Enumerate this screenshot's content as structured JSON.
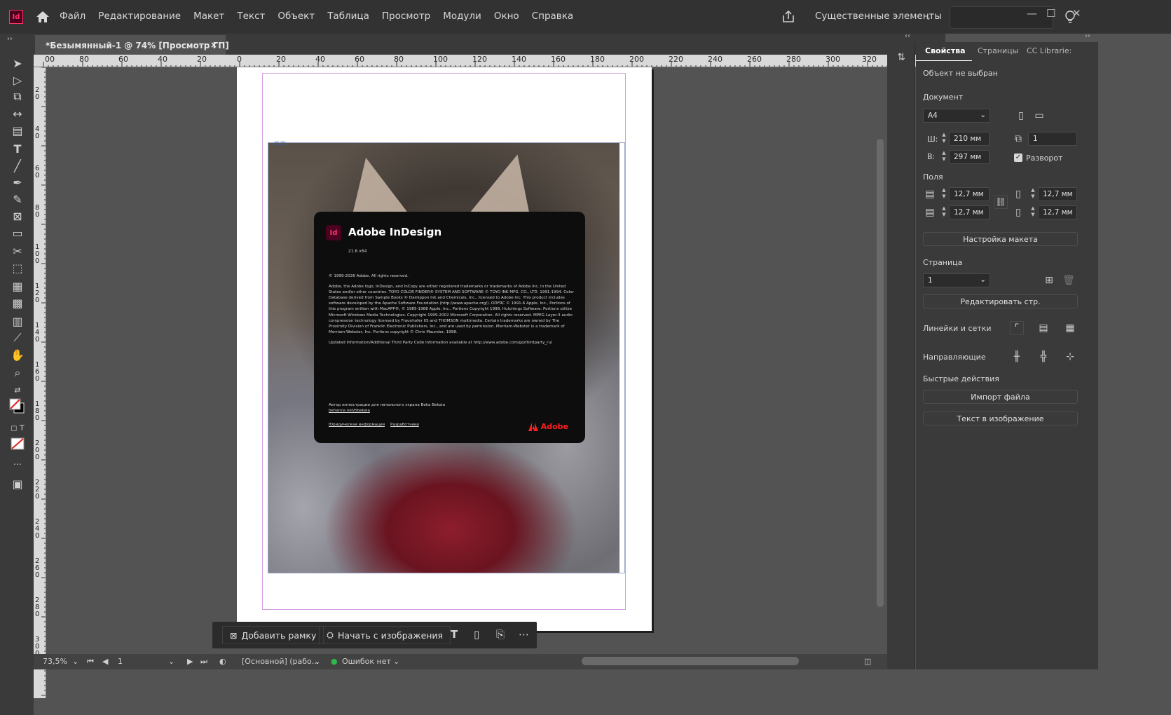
{
  "app": {
    "logo_text": "Id"
  },
  "menu": [
    "Файл",
    "Редактирование",
    "Макет",
    "Текст",
    "Объект",
    "Таблица",
    "Просмотр",
    "Модули",
    "Окно",
    "Справка"
  ],
  "workspace": {
    "label": "Существенные элементы"
  },
  "document_tab": {
    "title": "*Безымянный-1 @ 74% [Просмотр ГП]",
    "close": "×"
  },
  "ruler": {
    "h_ticks": [
      "00",
      "80",
      "60",
      "40",
      "20",
      "0",
      "20",
      "40",
      "60",
      "80",
      "100",
      "120",
      "140",
      "160",
      "180",
      "200",
      "220",
      "240",
      "260",
      "280",
      "300",
      "320"
    ],
    "v_ticks": [
      "2 0",
      "4 0",
      "6 0",
      "8 0",
      "1 0 0",
      "1 2 0",
      "1 4 0",
      "1 6 0",
      "1 8 0",
      "2 0 0",
      "2 2 0",
      "2 4 0",
      "2 6 0",
      "2 8 0",
      "3 0 0"
    ]
  },
  "splash": {
    "logo_text": "Id",
    "title": "Adobe InDesign",
    "version": "21.6 x64",
    "legal": [
      "© 1999-2026 Adobe. All rights reserved.",
      "Adobe, the Adobe logo, InDesign, and InCopy are either registered trademarks or trademarks of Adobe Inc. in the United States and/or other countries. TOYO COLOR FINDER® SYSTEM AND SOFTWARE © TOYO INK MFG. CO., LTD. 1991-1994. Color Database derived from Sample Books © Dainippon Ink and Chemicals, Inc., licensed to Adobe Inc. This product includes software developed by the Apache Software Foundation (http://www.apache.org/). ODFRC © 1991-6 Apple, Inc., Portions of this program written with MacAPP®, © 1985-1988 Apple, Inc., Portions Copyright 1998, Hutchings Software. Portions utilize Microsoft Windows Media Technologies. Copyright 1999-2002 Microsoft Corporation. All rights reserved. MPEG Layer-3 audio compression technology licensed by Fraunhofer IIS and THOMSON multimedia. Certain trademarks are owned by The Proximity Division of Franklin Electronic Publishers, Inc., and are used by permission. Merriam-Webster is a trademark of Merriam-Webster, Inc. Portions copyright © Chris Maunder, 1998.",
      "Updated Information/Additional Third Party Code Information available at http://www.adobe.com/go/thirdparty_ru/"
    ],
    "credit": "Автор иллюстрации для начального экрана Beka Bekaia",
    "credit_link": "behance.net/bbekaia",
    "link_legal": "Юридическая информация",
    "link_dev": "Разработчики",
    "adobe": "Adobe"
  },
  "contextbar": {
    "add_frame": "Добавить рамку",
    "start_image": "Начать с изображения"
  },
  "status": {
    "zoom": "73,5%",
    "page": "1",
    "style": "[Основной] (рабо...",
    "errors": "Ошибок нет"
  },
  "panel": {
    "tabs": [
      "Свойства",
      "Страницы",
      "CC Librarie:"
    ],
    "no_selection": "Объект не выбран",
    "document_label": "Документ",
    "page_size": "A4",
    "width_label": "Ш:",
    "width": "210 мм",
    "height_label": "В:",
    "height": "297 мм",
    "pages_count": "1",
    "facing_label": "Разворот",
    "margins_label": "Поля",
    "margin_top": "12,7 мм",
    "margin_bottom": "12,7 мм",
    "margin_left": "12,7 мм",
    "margin_right": "12,7 мм",
    "layout_btn": "Настройка макета",
    "page_label": "Страница",
    "page_value": "1",
    "edit_page_btn": "Редактировать стр.",
    "rulers_label": "Линейки и сетки",
    "guides_label": "Направляющие",
    "quick_label": "Быстрые действия",
    "import_btn": "Импорт файла",
    "text_image_btn": "Текст в изображение"
  },
  "colors": {
    "accent_id": "#ff3366",
    "adobe_red": "#ff1f1f",
    "status_ok": "#2fb84a"
  }
}
